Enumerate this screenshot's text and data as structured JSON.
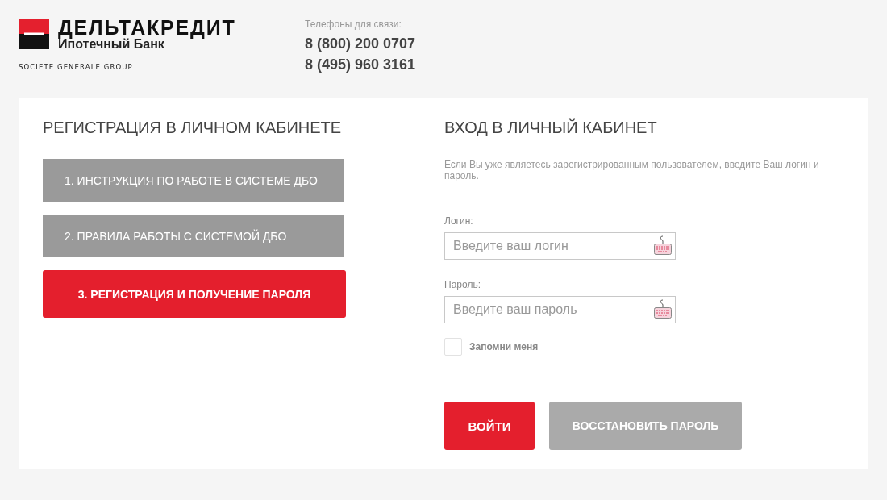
{
  "header": {
    "logo": {
      "name": "ДЕЛЬТАКРЕДИТ",
      "subtitle": "Ипотечный Банк",
      "group": "SOCIETE GENERALE GROUP"
    },
    "contacts": {
      "label": "Телефоны для связи:",
      "phones": [
        "8 (800) 200 0707",
        "8 (495) 960 3161"
      ]
    }
  },
  "registration": {
    "title": "РЕГИСТРАЦИЯ В ЛИЧНОМ КАБИНЕТЕ",
    "steps": [
      {
        "label": "1. ИНСТРУКЦИЯ ПО РАБОТЕ В СИСТЕМЕ ДБО",
        "selected": false
      },
      {
        "label": "2. ПРАВИЛА РАБОТЫ С СИСТЕМОЙ ДБО",
        "selected": false
      },
      {
        "label": "3. РЕГИСТРАЦИЯ И ПОЛУЧЕНИЕ ПАРОЛЯ",
        "selected": true
      }
    ]
  },
  "login": {
    "title": "ВХОД В ЛИЧНЫЙ КАБИНЕТ",
    "intro": "Если Вы уже являетесь зарегистрированным пользователем, введите Ваш логин и пароль.",
    "fields": [
      {
        "label": "Логин:",
        "placeholder": "Введите ваш логин"
      },
      {
        "label": "Пароль:",
        "placeholder": "Введите ваш пароль"
      }
    ],
    "remember": {
      "label": "Запомни меня",
      "checked": false
    },
    "buttons": [
      {
        "label": "ВОЙТИ",
        "kind": "primary"
      },
      {
        "label": "ВОССТАНОВИТЬ ПАРОЛЬ",
        "kind": "secondary"
      }
    ]
  }
}
